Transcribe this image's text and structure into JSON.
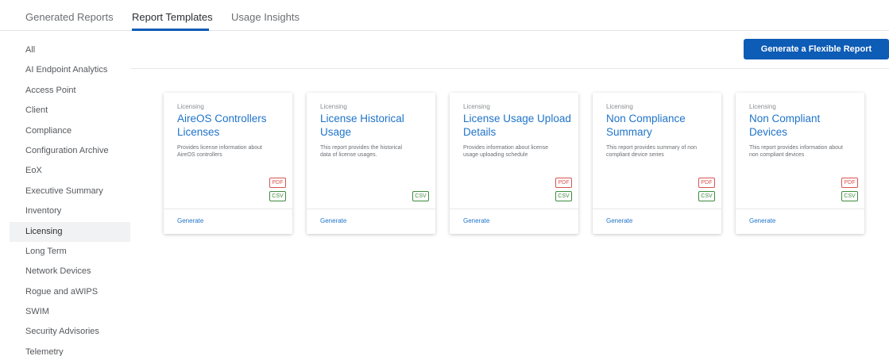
{
  "tabs": [
    {
      "label": "Generated Reports",
      "active": false
    },
    {
      "label": "Report Templates",
      "active": true
    },
    {
      "label": "Usage Insights",
      "active": false
    }
  ],
  "sidebar": {
    "items": [
      {
        "label": "All"
      },
      {
        "label": "AI Endpoint Analytics"
      },
      {
        "label": "Access Point"
      },
      {
        "label": "Client"
      },
      {
        "label": "Compliance"
      },
      {
        "label": "Configuration Archive"
      },
      {
        "label": "EoX"
      },
      {
        "label": "Executive Summary"
      },
      {
        "label": "Inventory"
      },
      {
        "label": "Licensing",
        "active": true
      },
      {
        "label": "Long Term"
      },
      {
        "label": "Network Devices"
      },
      {
        "label": "Rogue and aWIPS"
      },
      {
        "label": "SWIM"
      },
      {
        "label": "Security Advisories"
      },
      {
        "label": "Telemetry"
      }
    ]
  },
  "toolbar": {
    "generate_flexible_label": "Generate a Flexible Report"
  },
  "colors": {
    "accent": "#0d5cb6",
    "link": "#1f74c9",
    "pdf": "#d9534f",
    "csv": "#3f8a3f"
  },
  "cards": [
    {
      "category": "Licensing",
      "title": "AireOS Controllers Licenses",
      "description": "Provides license information about AireOS controllers",
      "pdf": "PDF",
      "csv": "CSV",
      "action": "Generate"
    },
    {
      "category": "Licensing",
      "title": "License Historical Usage",
      "description": "This report provides the historical data of license usages.",
      "pdf": null,
      "csv": "CSV",
      "action": "Generate"
    },
    {
      "category": "Licensing",
      "title": "License Usage Upload Details",
      "description": "Provides information about license usage uploading schedule",
      "pdf": "PDF",
      "csv": "CSV",
      "action": "Generate"
    },
    {
      "category": "Licensing",
      "title": "Non Compliance Summary",
      "description": "This report provides summary of non compliant device series",
      "pdf": "PDF",
      "csv": "CSV",
      "action": "Generate"
    },
    {
      "category": "Licensing",
      "title": "Non Compliant Devices",
      "description": "This report provides information about non compliant devices",
      "pdf": "PDF",
      "csv": "CSV",
      "action": "Generate"
    }
  ]
}
